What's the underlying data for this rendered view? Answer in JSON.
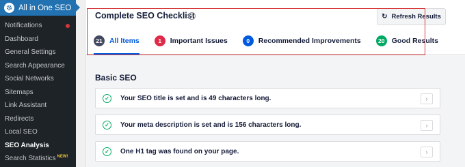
{
  "sidebar": {
    "title": "All in One SEO",
    "items": [
      {
        "label": "Notifications",
        "dot": true
      },
      {
        "label": "Dashboard"
      },
      {
        "label": "General Settings"
      },
      {
        "label": "Search Appearance"
      },
      {
        "label": "Social Networks"
      },
      {
        "label": "Sitemaps"
      },
      {
        "label": "Link Assistant"
      },
      {
        "label": "Redirects"
      },
      {
        "label": "Local SEO"
      },
      {
        "label": "SEO Analysis",
        "active": true
      },
      {
        "label": "Search Statistics",
        "badge": "NEW!"
      }
    ]
  },
  "header": {
    "title": "Complete SEO Checklist",
    "help_icon": "question-circle-icon",
    "refresh_label": "Refresh Results",
    "refresh_icon": "refresh-icon"
  },
  "tabs": [
    {
      "count": "21",
      "label": "All Items",
      "color": "#434960",
      "active": true
    },
    {
      "count": "1",
      "label": "Important Issues",
      "color": "#df2a4a"
    },
    {
      "count": "0",
      "label": "Recommended Improvements",
      "color": "#005ae0"
    },
    {
      "count": "20",
      "label": "Good Results",
      "color": "#00aa63"
    }
  ],
  "section": {
    "title": "Basic SEO",
    "items": [
      {
        "text": "Your SEO title is set and is 49 characters long.",
        "icon": "check-circle-icon"
      },
      {
        "text": "Your meta description is set and is 156 characters long.",
        "icon": "check-circle-icon"
      },
      {
        "text": "One H1 tag was found on your page.",
        "icon": "check-circle-icon"
      }
    ]
  },
  "colors": {
    "accent": "#005ae0",
    "brand": "#2271b1",
    "highlight": "#d63638",
    "good": "#00aa63"
  }
}
